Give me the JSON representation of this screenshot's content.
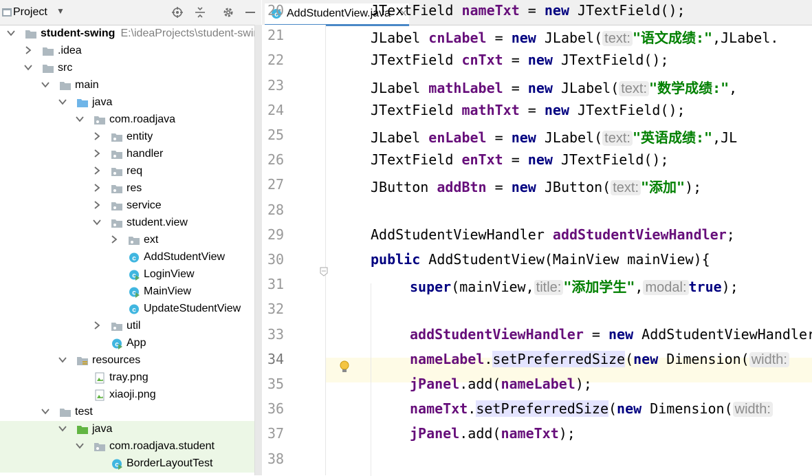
{
  "project_panel": {
    "title": "Project",
    "tree": [
      {
        "label": "student-swing",
        "path": "E:\\ideaProjects\\student-swing",
        "depth": 0,
        "expanded": true,
        "type": "module",
        "bold": true
      },
      {
        "label": ".idea",
        "depth": 1,
        "expanded": false,
        "type": "folder"
      },
      {
        "label": "src",
        "depth": 1,
        "expanded": true,
        "type": "folder"
      },
      {
        "label": "main",
        "depth": 2,
        "expanded": true,
        "type": "folder"
      },
      {
        "label": "java",
        "depth": 3,
        "expanded": true,
        "type": "source-folder"
      },
      {
        "label": "com.roadjava",
        "depth": 4,
        "expanded": true,
        "type": "package"
      },
      {
        "label": "entity",
        "depth": 5,
        "expanded": false,
        "type": "package"
      },
      {
        "label": "handler",
        "depth": 5,
        "expanded": false,
        "type": "package"
      },
      {
        "label": "req",
        "depth": 5,
        "expanded": false,
        "type": "package"
      },
      {
        "label": "res",
        "depth": 5,
        "expanded": false,
        "type": "package"
      },
      {
        "label": "service",
        "depth": 5,
        "expanded": false,
        "type": "package"
      },
      {
        "label": "student.view",
        "depth": 5,
        "expanded": true,
        "type": "package"
      },
      {
        "label": "ext",
        "depth": 6,
        "expanded": false,
        "type": "package"
      },
      {
        "label": "AddStudentView",
        "depth": 6,
        "type": "class"
      },
      {
        "label": "LoginView",
        "depth": 6,
        "type": "class-run"
      },
      {
        "label": "MainView",
        "depth": 6,
        "type": "class-run"
      },
      {
        "label": "UpdateStudentView",
        "depth": 6,
        "type": "class"
      },
      {
        "label": "util",
        "depth": 5,
        "expanded": false,
        "type": "package"
      },
      {
        "label": "App",
        "depth": 5,
        "type": "class-run"
      },
      {
        "label": "resources",
        "depth": 3,
        "expanded": true,
        "type": "resource-folder"
      },
      {
        "label": "tray.png",
        "depth": 4,
        "type": "image"
      },
      {
        "label": "xiaoji.png",
        "depth": 4,
        "type": "image"
      },
      {
        "label": "test",
        "depth": 2,
        "expanded": true,
        "type": "folder"
      },
      {
        "label": "java",
        "depth": 3,
        "expanded": true,
        "type": "test-folder",
        "green": true
      },
      {
        "label": "com.roadjava.student",
        "depth": 4,
        "expanded": true,
        "type": "package",
        "green": true
      },
      {
        "label": "BorderLayoutTest",
        "depth": 5,
        "type": "class-run",
        "green": true
      }
    ]
  },
  "editor": {
    "tab_label": "AddStudentView.java",
    "current_line": "34",
    "lines": [
      {
        "n": "20",
        "tokens": [
          {
            "t": "JTextField ",
            "c": ""
          },
          {
            "t": "nameTxt",
            "c": "fld"
          },
          {
            "t": " = ",
            "c": ""
          },
          {
            "t": "new",
            "c": "kw"
          },
          {
            "t": " JTextField();",
            "c": ""
          }
        ]
      },
      {
        "n": "21",
        "tokens": [
          {
            "t": "JLabel ",
            "c": ""
          },
          {
            "t": "cnLabel",
            "c": "fld"
          },
          {
            "t": " = ",
            "c": ""
          },
          {
            "t": "new",
            "c": "kw"
          },
          {
            "t": " JLabel(",
            "c": ""
          },
          {
            "t": "text:",
            "c": "hint"
          },
          {
            "t": "\"语文成绩:\"",
            "c": "str"
          },
          {
            "t": ",JLabel.",
            "c": ""
          }
        ]
      },
      {
        "n": "22",
        "tokens": [
          {
            "t": "JTextField ",
            "c": ""
          },
          {
            "t": "cnTxt",
            "c": "fld"
          },
          {
            "t": " = ",
            "c": ""
          },
          {
            "t": "new",
            "c": "kw"
          },
          {
            "t": " JTextField();",
            "c": ""
          }
        ]
      },
      {
        "n": "23",
        "tokens": [
          {
            "t": "JLabel ",
            "c": ""
          },
          {
            "t": "mathLabel",
            "c": "fld"
          },
          {
            "t": " = ",
            "c": ""
          },
          {
            "t": "new",
            "c": "kw"
          },
          {
            "t": " JLabel(",
            "c": ""
          },
          {
            "t": "text:",
            "c": "hint"
          },
          {
            "t": "\"数学成绩:\"",
            "c": "str"
          },
          {
            "t": ",",
            "c": ""
          }
        ]
      },
      {
        "n": "24",
        "tokens": [
          {
            "t": "JTextField ",
            "c": ""
          },
          {
            "t": "mathTxt",
            "c": "fld"
          },
          {
            "t": " = ",
            "c": ""
          },
          {
            "t": "new",
            "c": "kw"
          },
          {
            "t": " JTextField();",
            "c": ""
          }
        ]
      },
      {
        "n": "25",
        "tokens": [
          {
            "t": "JLabel ",
            "c": ""
          },
          {
            "t": "enLabel",
            "c": "fld"
          },
          {
            "t": " = ",
            "c": ""
          },
          {
            "t": "new",
            "c": "kw"
          },
          {
            "t": " JLabel(",
            "c": ""
          },
          {
            "t": "text:",
            "c": "hint"
          },
          {
            "t": "\"英语成绩:\"",
            "c": "str"
          },
          {
            "t": ",JL",
            "c": ""
          }
        ]
      },
      {
        "n": "26",
        "tokens": [
          {
            "t": "JTextField ",
            "c": ""
          },
          {
            "t": "enTxt",
            "c": "fld"
          },
          {
            "t": " = ",
            "c": ""
          },
          {
            "t": "new",
            "c": "kw"
          },
          {
            "t": " JTextField();",
            "c": ""
          }
        ]
      },
      {
        "n": "27",
        "tokens": [
          {
            "t": "JButton ",
            "c": ""
          },
          {
            "t": "addBtn",
            "c": "fld"
          },
          {
            "t": " = ",
            "c": ""
          },
          {
            "t": "new",
            "c": "kw"
          },
          {
            "t": " JButton(",
            "c": ""
          },
          {
            "t": "text:",
            "c": "hint"
          },
          {
            "t": "\"添加\"",
            "c": "str"
          },
          {
            "t": ");",
            "c": ""
          }
        ]
      },
      {
        "n": "28",
        "tokens": []
      },
      {
        "n": "29",
        "tokens": [
          {
            "t": "AddStudentViewHandler ",
            "c": ""
          },
          {
            "t": "addStudentViewHandler",
            "c": "fld"
          },
          {
            "t": ";",
            "c": ""
          }
        ]
      },
      {
        "n": "30",
        "tokens": [
          {
            "t": "public",
            "c": "kw"
          },
          {
            "t": " AddStudentView(MainView mainView){",
            "c": ""
          }
        ]
      },
      {
        "n": "31",
        "indent": true,
        "tokens": [
          {
            "t": "super",
            "c": "kw"
          },
          {
            "t": "(mainView,",
            "c": ""
          },
          {
            "t": "title:",
            "c": "hint"
          },
          {
            "t": "\"添加学生\"",
            "c": "str"
          },
          {
            "t": ",",
            "c": ""
          },
          {
            "t": "modal:",
            "c": "hint"
          },
          {
            "t": "true",
            "c": "kw"
          },
          {
            "t": ");",
            "c": ""
          }
        ]
      },
      {
        "n": "32",
        "tokens": []
      },
      {
        "n": "33",
        "indent": true,
        "tokens": [
          {
            "t": "addStudentViewHandler",
            "c": "fld"
          },
          {
            "t": " = ",
            "c": ""
          },
          {
            "t": "new",
            "c": "kw"
          },
          {
            "t": " AddStudentViewHandler(",
            "c": ""
          }
        ]
      },
      {
        "n": "34",
        "indent": true,
        "tokens": [
          {
            "t": "nameLabel",
            "c": "fld"
          },
          {
            "t": ".",
            "c": ""
          },
          {
            "t": "setPreferredSize",
            "c": "meth"
          },
          {
            "t": "(",
            "c": ""
          },
          {
            "t": "new",
            "c": "kw"
          },
          {
            "t": " Dimension(",
            "c": ""
          },
          {
            "t": "width:",
            "c": "hint"
          }
        ]
      },
      {
        "n": "35",
        "indent": true,
        "tokens": [
          {
            "t": "jPanel",
            "c": "fld"
          },
          {
            "t": ".add(",
            "c": ""
          },
          {
            "t": "nameLabel",
            "c": "fld"
          },
          {
            "t": ");",
            "c": ""
          }
        ]
      },
      {
        "n": "36",
        "indent": true,
        "tokens": [
          {
            "t": "nameTxt",
            "c": "fld"
          },
          {
            "t": ".",
            "c": ""
          },
          {
            "t": "setPreferredSize",
            "c": "meth"
          },
          {
            "t": "(",
            "c": ""
          },
          {
            "t": "new",
            "c": "kw"
          },
          {
            "t": " Dimension(",
            "c": ""
          },
          {
            "t": "width:",
            "c": "hint"
          }
        ]
      },
      {
        "n": "37",
        "indent": true,
        "tokens": [
          {
            "t": "jPanel",
            "c": "fld"
          },
          {
            "t": ".add(",
            "c": ""
          },
          {
            "t": "nameTxt",
            "c": "fld"
          },
          {
            "t": ");",
            "c": ""
          }
        ]
      },
      {
        "n": "38",
        "tokens": []
      }
    ]
  },
  "colors": {
    "keyword": "#000080",
    "field": "#660e7a",
    "string": "#008000",
    "hint_bg": "#ededed",
    "accent": "#4a88c7",
    "current_line_bg": "#fefbe6"
  },
  "icons": [
    "project-icon",
    "locate-icon",
    "collapse-all-icon",
    "gear-icon",
    "hide-icon",
    "java-class-icon",
    "lightbulb-icon",
    "fold-icon"
  ]
}
